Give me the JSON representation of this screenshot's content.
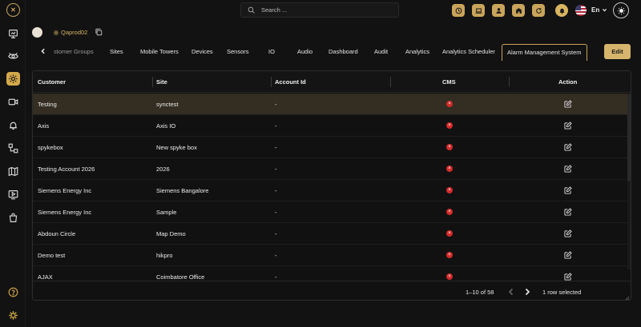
{
  "colors": {
    "accent": "#c9a45a",
    "edit_button": "#d6b46c",
    "selected_row": "#332d22",
    "cms_error": "#d42a2a",
    "background": "#121212"
  },
  "sidebar": {
    "logo_icon": "logo-icon",
    "items": [
      {
        "name": "dashboard-icon"
      },
      {
        "name": "vision-icon"
      },
      {
        "name": "settings-icon",
        "active": true
      },
      {
        "name": "camera-icon"
      },
      {
        "name": "alarm-icon"
      },
      {
        "name": "flow-icon"
      },
      {
        "name": "map-icon"
      },
      {
        "name": "playback-icon"
      },
      {
        "name": "bag-icon"
      }
    ],
    "bottom": [
      {
        "name": "help-icon"
      },
      {
        "name": "gear-icon"
      }
    ]
  },
  "topbar": {
    "search_placeholder": "Search ...",
    "buttons": [
      "clock-icon",
      "laptop-icon",
      "user-icon",
      "building-icon",
      "refresh-icon",
      "notifications-icon"
    ],
    "language": "En"
  },
  "header": {
    "tenant_name": "Qaprod02"
  },
  "tabs": [
    {
      "label": "stomer Groups"
    },
    {
      "label": "Sites"
    },
    {
      "label": "Mobile Towers"
    },
    {
      "label": "Devices"
    },
    {
      "label": "Sensors"
    },
    {
      "label": "IO"
    },
    {
      "label": "Audio"
    },
    {
      "label": "Dashboard"
    },
    {
      "label": "Audit"
    },
    {
      "label": "Analytics"
    },
    {
      "label": "Analytics Scheduler"
    },
    {
      "label": "Alarm Management System",
      "active": true
    }
  ],
  "edit_label": "Edit",
  "table": {
    "columns": [
      "Customer",
      "Site",
      "Account Id",
      "CMS",
      "Action"
    ],
    "rows": [
      {
        "customer": "Testing",
        "site": "synctest",
        "account_id": "-",
        "selected": true
      },
      {
        "customer": "Axis",
        "site": "Axis IO",
        "account_id": "-"
      },
      {
        "customer": "spykebox",
        "site": "New spyke box",
        "account_id": "-"
      },
      {
        "customer": "Testing Account 2026",
        "site": "2026",
        "account_id": "-"
      },
      {
        "customer": "Siemens Energy Inc",
        "site": "Siemens Bangalore",
        "account_id": "-"
      },
      {
        "customer": "Siemens Energy Inc",
        "site": "Sample",
        "account_id": "-"
      },
      {
        "customer": "Abdoun Circle",
        "site": "Map Demo",
        "account_id": "-"
      },
      {
        "customer": "Demo test",
        "site": "hikpro",
        "account_id": "-"
      },
      {
        "customer": "AJAX",
        "site": "Coimbatore Office",
        "account_id": "-"
      }
    ],
    "cms_icon": "close-circle-icon",
    "cms_icon_glyph": "×",
    "action_icon": "edit-icon"
  },
  "pagination": {
    "range": "1–10 of 58",
    "selection": "1 row selected"
  }
}
